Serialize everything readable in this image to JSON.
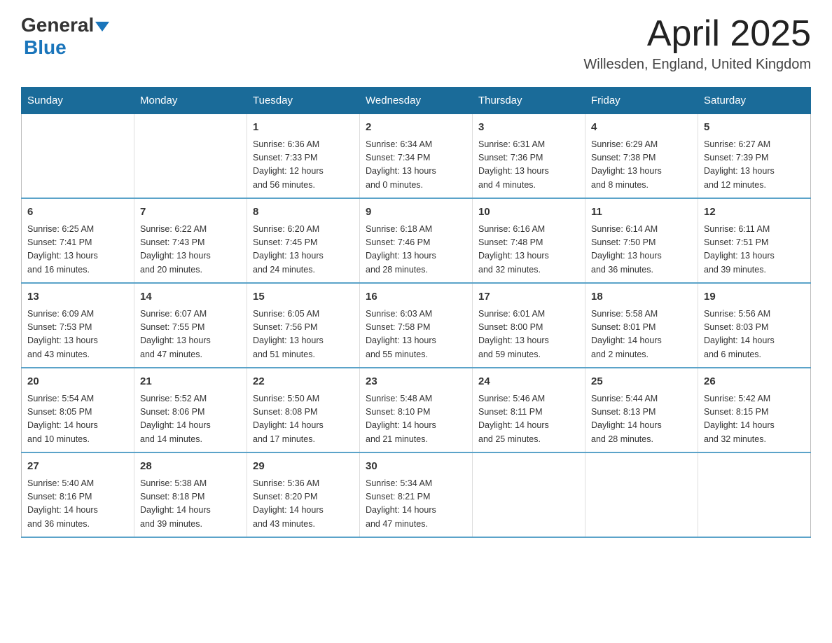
{
  "header": {
    "logo_general": "General",
    "logo_blue": "Blue",
    "month_title": "April 2025",
    "location": "Willesden, England, United Kingdom"
  },
  "days_of_week": [
    "Sunday",
    "Monday",
    "Tuesday",
    "Wednesday",
    "Thursday",
    "Friday",
    "Saturday"
  ],
  "weeks": [
    [
      {
        "day": "",
        "info": ""
      },
      {
        "day": "",
        "info": ""
      },
      {
        "day": "1",
        "info": "Sunrise: 6:36 AM\nSunset: 7:33 PM\nDaylight: 12 hours\nand 56 minutes."
      },
      {
        "day": "2",
        "info": "Sunrise: 6:34 AM\nSunset: 7:34 PM\nDaylight: 13 hours\nand 0 minutes."
      },
      {
        "day": "3",
        "info": "Sunrise: 6:31 AM\nSunset: 7:36 PM\nDaylight: 13 hours\nand 4 minutes."
      },
      {
        "day": "4",
        "info": "Sunrise: 6:29 AM\nSunset: 7:38 PM\nDaylight: 13 hours\nand 8 minutes."
      },
      {
        "day": "5",
        "info": "Sunrise: 6:27 AM\nSunset: 7:39 PM\nDaylight: 13 hours\nand 12 minutes."
      }
    ],
    [
      {
        "day": "6",
        "info": "Sunrise: 6:25 AM\nSunset: 7:41 PM\nDaylight: 13 hours\nand 16 minutes."
      },
      {
        "day": "7",
        "info": "Sunrise: 6:22 AM\nSunset: 7:43 PM\nDaylight: 13 hours\nand 20 minutes."
      },
      {
        "day": "8",
        "info": "Sunrise: 6:20 AM\nSunset: 7:45 PM\nDaylight: 13 hours\nand 24 minutes."
      },
      {
        "day": "9",
        "info": "Sunrise: 6:18 AM\nSunset: 7:46 PM\nDaylight: 13 hours\nand 28 minutes."
      },
      {
        "day": "10",
        "info": "Sunrise: 6:16 AM\nSunset: 7:48 PM\nDaylight: 13 hours\nand 32 minutes."
      },
      {
        "day": "11",
        "info": "Sunrise: 6:14 AM\nSunset: 7:50 PM\nDaylight: 13 hours\nand 36 minutes."
      },
      {
        "day": "12",
        "info": "Sunrise: 6:11 AM\nSunset: 7:51 PM\nDaylight: 13 hours\nand 39 minutes."
      }
    ],
    [
      {
        "day": "13",
        "info": "Sunrise: 6:09 AM\nSunset: 7:53 PM\nDaylight: 13 hours\nand 43 minutes."
      },
      {
        "day": "14",
        "info": "Sunrise: 6:07 AM\nSunset: 7:55 PM\nDaylight: 13 hours\nand 47 minutes."
      },
      {
        "day": "15",
        "info": "Sunrise: 6:05 AM\nSunset: 7:56 PM\nDaylight: 13 hours\nand 51 minutes."
      },
      {
        "day": "16",
        "info": "Sunrise: 6:03 AM\nSunset: 7:58 PM\nDaylight: 13 hours\nand 55 minutes."
      },
      {
        "day": "17",
        "info": "Sunrise: 6:01 AM\nSunset: 8:00 PM\nDaylight: 13 hours\nand 59 minutes."
      },
      {
        "day": "18",
        "info": "Sunrise: 5:58 AM\nSunset: 8:01 PM\nDaylight: 14 hours\nand 2 minutes."
      },
      {
        "day": "19",
        "info": "Sunrise: 5:56 AM\nSunset: 8:03 PM\nDaylight: 14 hours\nand 6 minutes."
      }
    ],
    [
      {
        "day": "20",
        "info": "Sunrise: 5:54 AM\nSunset: 8:05 PM\nDaylight: 14 hours\nand 10 minutes."
      },
      {
        "day": "21",
        "info": "Sunrise: 5:52 AM\nSunset: 8:06 PM\nDaylight: 14 hours\nand 14 minutes."
      },
      {
        "day": "22",
        "info": "Sunrise: 5:50 AM\nSunset: 8:08 PM\nDaylight: 14 hours\nand 17 minutes."
      },
      {
        "day": "23",
        "info": "Sunrise: 5:48 AM\nSunset: 8:10 PM\nDaylight: 14 hours\nand 21 minutes."
      },
      {
        "day": "24",
        "info": "Sunrise: 5:46 AM\nSunset: 8:11 PM\nDaylight: 14 hours\nand 25 minutes."
      },
      {
        "day": "25",
        "info": "Sunrise: 5:44 AM\nSunset: 8:13 PM\nDaylight: 14 hours\nand 28 minutes."
      },
      {
        "day": "26",
        "info": "Sunrise: 5:42 AM\nSunset: 8:15 PM\nDaylight: 14 hours\nand 32 minutes."
      }
    ],
    [
      {
        "day": "27",
        "info": "Sunrise: 5:40 AM\nSunset: 8:16 PM\nDaylight: 14 hours\nand 36 minutes."
      },
      {
        "day": "28",
        "info": "Sunrise: 5:38 AM\nSunset: 8:18 PM\nDaylight: 14 hours\nand 39 minutes."
      },
      {
        "day": "29",
        "info": "Sunrise: 5:36 AM\nSunset: 8:20 PM\nDaylight: 14 hours\nand 43 minutes."
      },
      {
        "day": "30",
        "info": "Sunrise: 5:34 AM\nSunset: 8:21 PM\nDaylight: 14 hours\nand 47 minutes."
      },
      {
        "day": "",
        "info": ""
      },
      {
        "day": "",
        "info": ""
      },
      {
        "day": "",
        "info": ""
      }
    ]
  ]
}
